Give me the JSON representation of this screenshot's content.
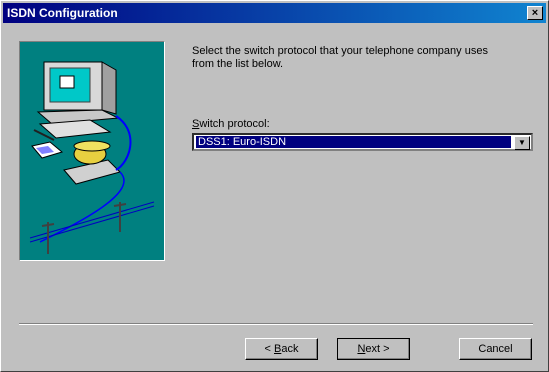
{
  "window": {
    "title": "ISDN Configuration",
    "close_glyph": "×"
  },
  "instructions": {
    "line1": "Select the switch protocol that your telephone company uses",
    "line2": "from the list below."
  },
  "switch_protocol": {
    "label_accel": "S",
    "label_rest": "witch protocol:",
    "selected": "DSS1: Euro-ISDN"
  },
  "buttons": {
    "back_prefix": "< ",
    "back_accel": "B",
    "back_rest": "ack",
    "next_accel": "N",
    "next_rest": "ext >",
    "cancel": "Cancel"
  },
  "icons": [
    "close-icon",
    "wizard-illustration",
    "chevron-down-icon"
  ],
  "colors": {
    "titlebar": "#000080",
    "selection": "#000080",
    "illustration_bg": "#008080"
  }
}
